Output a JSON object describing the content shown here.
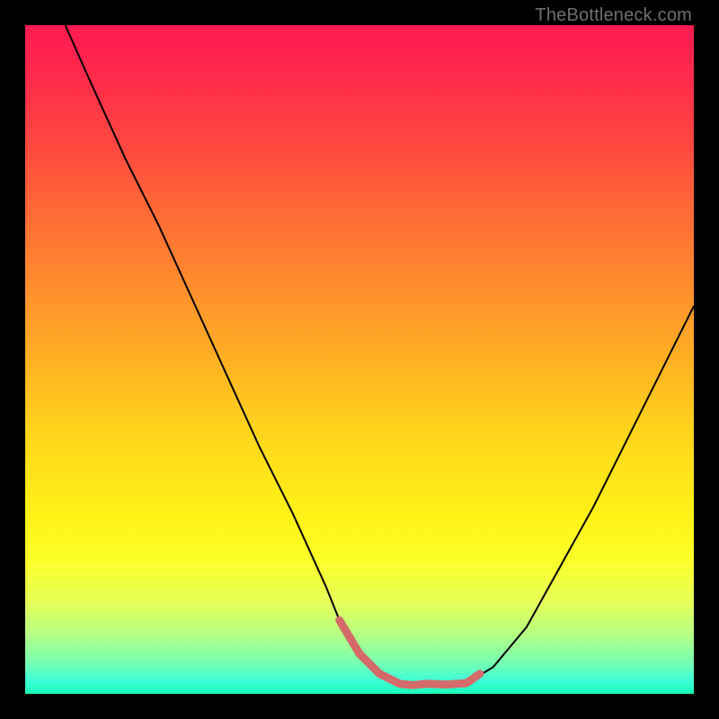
{
  "watermark": "TheBottleneck.com",
  "colors": {
    "frame": "#000000",
    "curve_stroke": "#000000",
    "highlight_stroke": "#d46a6a",
    "gradient_top": "#ff1a52",
    "gradient_bottom": "#18ffb8"
  },
  "chart_data": {
    "type": "line",
    "title": "",
    "xlabel": "",
    "ylabel": "",
    "xlim": [
      0,
      100
    ],
    "ylim": [
      0,
      100
    ],
    "grid": false,
    "series": [
      {
        "name": "bottleneck-curve",
        "stroke": "#000000",
        "x": [
          6,
          10,
          15,
          20,
          25,
          30,
          35,
          40,
          45,
          47,
          50,
          53,
          56,
          58,
          60,
          63,
          66,
          70,
          75,
          80,
          85,
          90,
          95,
          100
        ],
        "y": [
          100,
          91,
          80,
          70,
          59,
          48,
          37,
          27,
          16,
          11,
          6,
          3,
          1.5,
          1.3,
          1.5,
          1.4,
          1.6,
          4,
          10,
          19,
          28,
          38,
          48,
          58
        ]
      },
      {
        "name": "zero-bottleneck-band",
        "stroke": "#d46a6a",
        "x": [
          47,
          50,
          53,
          56,
          58,
          60,
          63,
          66,
          68
        ],
        "y": [
          11,
          6,
          3,
          1.5,
          1.3,
          1.5,
          1.4,
          1.6,
          3
        ]
      }
    ],
    "annotations": []
  }
}
